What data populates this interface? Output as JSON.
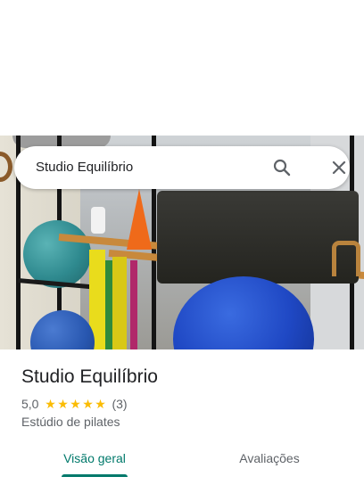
{
  "search": {
    "query": "Studio Equilíbrio",
    "search_icon": "search-icon",
    "close_icon": "close-icon"
  },
  "hero": {
    "description_icon": "place-photo"
  },
  "place": {
    "name": "Studio Equilíbrio",
    "rating": "5,0",
    "stars": 5,
    "review_count": "(3)",
    "category": "Estúdio de pilates"
  },
  "tabs": [
    {
      "label": "Visão geral",
      "selected": true
    },
    {
      "label": "Avaliações",
      "selected": false
    }
  ],
  "colors": {
    "accent": "#00796b",
    "star": "#fbbc04",
    "text_primary": "#202124",
    "text_secondary": "#5f6368"
  }
}
